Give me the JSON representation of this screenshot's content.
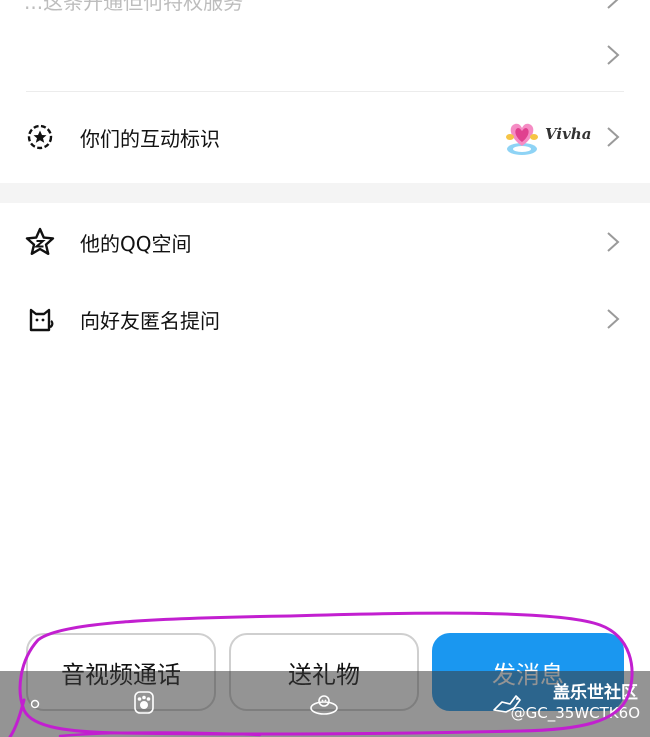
{
  "top_partial": {
    "text": "...这条开通但何特权服务"
  },
  "rows": {
    "interaction_badge": {
      "label": "你们的互动标识",
      "badge_text": "Vivha"
    },
    "qq_space": {
      "label": "他的QQ空间"
    },
    "anon_question": {
      "label": "向好友匿名提问"
    }
  },
  "actions": {
    "call_label": "音视频通话",
    "gift_label": "送礼物",
    "message_label": "发消息"
  },
  "watermark": {
    "title": "盖乐世社区",
    "handle": "@GC_35WCTK6O"
  },
  "colors": {
    "primary": "#1a97f0",
    "annotation": "#c21fd0"
  }
}
